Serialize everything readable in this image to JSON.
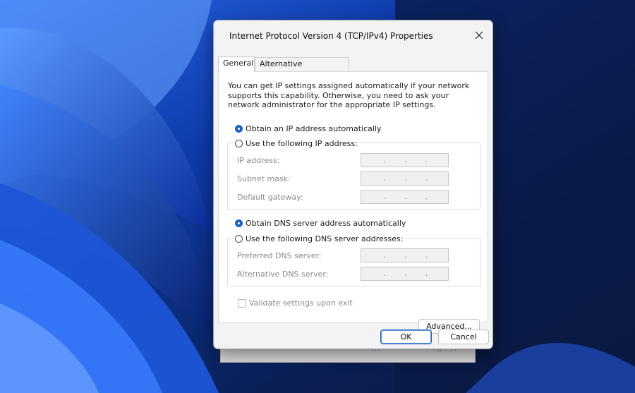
{
  "window": {
    "title": "Internet Protocol Version 4 (TCP/IPv4) Properties"
  },
  "tabs": [
    {
      "label": "General",
      "active": true
    },
    {
      "label": "Alternative Configuration",
      "active": false
    }
  ],
  "general": {
    "intro": "You can get IP settings assigned automatically if your network supports this capability. Otherwise, you need to ask your network administrator for the appropriate IP settings.",
    "ip_auto_label": "Obtain an IP address automatically",
    "ip_manual_label": "Use the following IP address:",
    "ip_mode_selected": "auto",
    "ip_fields": [
      {
        "label": "IP address:",
        "value": ". . ."
      },
      {
        "label": "Subnet mask:",
        "value": ". . ."
      },
      {
        "label": "Default gateway:",
        "value": ". . ."
      }
    ],
    "dns_auto_label": "Obtain DNS server address automatically",
    "dns_manual_label": "Use the following DNS server addresses:",
    "dns_mode_selected": "auto",
    "dns_fields": [
      {
        "label": "Preferred DNS server:",
        "value": ". . ."
      },
      {
        "label": "Alternative DNS server:",
        "value": ". . ."
      }
    ],
    "validate_label": "Validate settings upon exit",
    "validate_checked": false,
    "advanced_label": "Advanced..."
  },
  "footer": {
    "ok_label": "OK",
    "cancel_label": "Cancel"
  },
  "background_dialog": {
    "ok_label": "OK",
    "cancel_label": "Cancel"
  },
  "colors": {
    "accent": "#1d64c2",
    "wallpaper_dark": "#0a1f55",
    "wallpaper_bright": "#2f7bff"
  }
}
